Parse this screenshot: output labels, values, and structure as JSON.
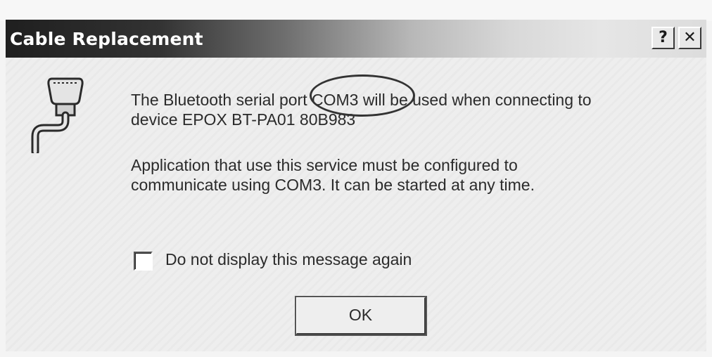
{
  "window": {
    "title": "Cable Replacement",
    "help_label": "?",
    "close_label": "✕"
  },
  "icon": {
    "name": "serial-cable-icon"
  },
  "message": {
    "line1": "The Bluetooth serial port COM3 will be used when connecting to\ndevice EPOX BT-PA01 80B983",
    "line2": "Application that use this service must be configured to\ncommunicate using COM3.  It can be started at any time."
  },
  "checkbox": {
    "label": "Do not display this message again",
    "checked": false
  },
  "buttons": {
    "ok_label": "OK"
  }
}
